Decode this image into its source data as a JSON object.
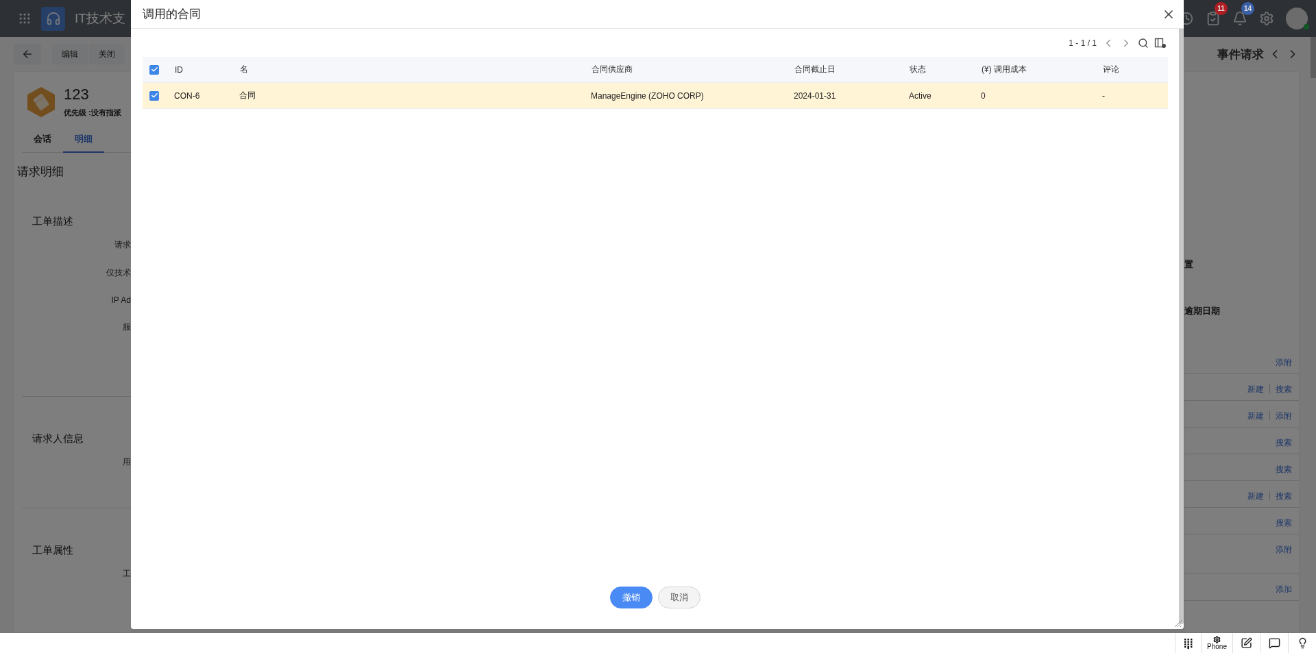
{
  "app_header": {
    "title": "IT技术支",
    "notifications": [
      {
        "kind": "tasks",
        "count": "11",
        "color": "#b01e24"
      },
      {
        "kind": "bell",
        "count": "14",
        "color": "#3a5fa8"
      }
    ]
  },
  "toolbar": {
    "buttons": [
      "编辑",
      "关闭"
    ]
  },
  "request": {
    "id": "123",
    "priority": "优先级 :没有指派",
    "tabs": [
      {
        "label": "会话",
        "selected": false
      },
      {
        "label": "明细",
        "selected": true
      }
    ]
  },
  "details": {
    "title": "请求明细",
    "sections": [
      {
        "title": "工单描述",
        "fields": [
          "请求",
          "仅技术",
          "IP Ad",
          "服"
        ]
      },
      {
        "title": "请求人信息",
        "fields": [
          "用"
        ]
      },
      {
        "title": "工单属性",
        "fields": [
          "工"
        ]
      }
    ]
  },
  "side_panel": {
    "title": "事件请求",
    "labels": [
      "置",
      "逾期日期"
    ],
    "link_rows": [
      [
        "添附"
      ],
      [
        "新建",
        "搜索"
      ],
      [
        "新建",
        "添附"
      ],
      [
        "搜索"
      ],
      [
        "搜索"
      ],
      [
        "新建",
        "搜索"
      ],
      [
        "搜索"
      ],
      [
        "添附"
      ],
      [
        "添加"
      ]
    ]
  },
  "dialog": {
    "title": "调用的合同",
    "pager": "1 - 1 / 1",
    "table": {
      "all_checked": true,
      "columns": [
        "ID",
        "名",
        "合同供应商",
        "合同截止日",
        "状态",
        "(¥) 调用成本",
        "评论"
      ],
      "rows": [
        {
          "selected": true,
          "cells": [
            "CON-6",
            "合同",
            "ManageEngine (ZOHO CORP)",
            "2024-01-31",
            "Active",
            "0",
            "-"
          ]
        }
      ]
    },
    "buttons": [
      {
        "label": "撤销",
        "kind": "primary"
      },
      {
        "label": "取消",
        "kind": "secondary"
      }
    ]
  },
  "bottom_bar": {
    "phone_label": "Phone"
  }
}
